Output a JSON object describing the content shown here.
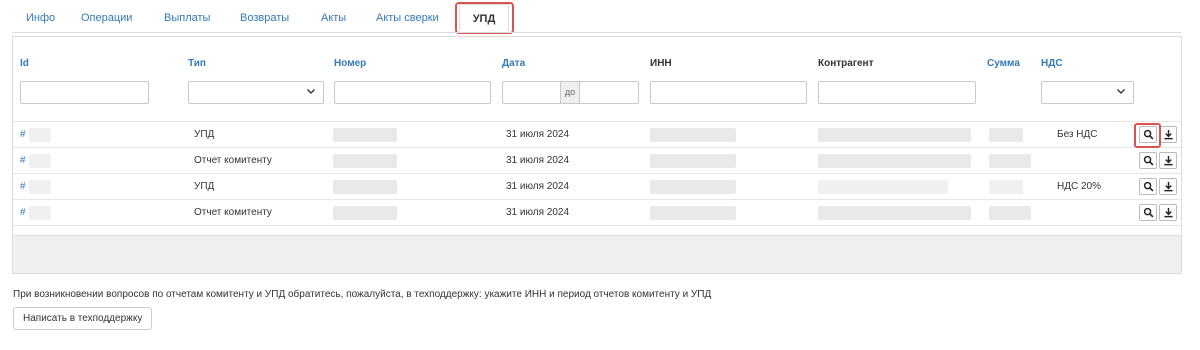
{
  "tabs": [
    {
      "label": "Инфо"
    },
    {
      "label": "Операции"
    },
    {
      "label": "Выплаты"
    },
    {
      "label": "Возвраты"
    },
    {
      "label": "Акты"
    },
    {
      "label": "Акты сверки"
    },
    {
      "label": "УПД",
      "active": true
    }
  ],
  "table": {
    "headers": {
      "id": "Id",
      "type": "Тип",
      "number": "Номер",
      "date": "Дата",
      "inn": "ИНН",
      "counterparty": "Контрагент",
      "sum": "Сумма",
      "vat": "НДС"
    },
    "filters": {
      "id": "",
      "type": "",
      "number": "",
      "date_separator": "до",
      "inn": "",
      "counterparty": "",
      "vat": ""
    },
    "rows": [
      {
        "id_prefix": "#",
        "type": "УПД",
        "date": "31 июля 2024",
        "vat": "Без НДС"
      },
      {
        "id_prefix": "#",
        "type": "Отчет комитенту",
        "date": "31 июля 2024",
        "vat": ""
      },
      {
        "id_prefix": "#",
        "type": "УПД",
        "date": "31 июля 2024",
        "vat": "НДС 20%"
      },
      {
        "id_prefix": "#",
        "type": "Отчет комитенту",
        "date": "31 июля 2024",
        "vat": ""
      }
    ]
  },
  "footer": {
    "note": "При возникновении вопросов по отчетам комитенту и УПД обратитесь, пожалуйста, в техподдержку: укажите ИНН и период отчетов комитенту и УПД",
    "support_button": "Написать в техподдержку"
  },
  "colors": {
    "link": "#337ab7",
    "highlight": "#d9534f",
    "border": "#dcdcdc"
  }
}
